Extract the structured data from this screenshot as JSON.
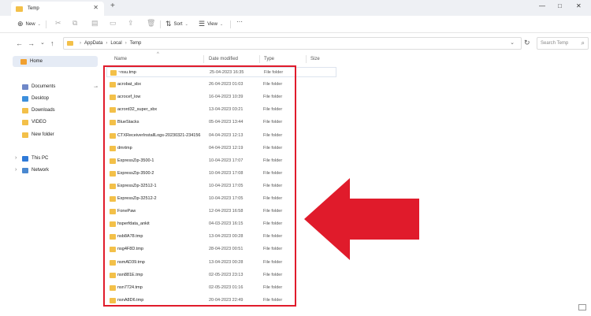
{
  "window": {
    "tab_title": "Temp",
    "tab_close": "✕",
    "new_tab": "+",
    "minimize": "—",
    "maximize": "□",
    "close": "✕"
  },
  "toolbar": {
    "new_label": "New",
    "sort_label": "Sort",
    "view_label": "View",
    "more_label": "···"
  },
  "address": {
    "crumbs": [
      "AppData",
      "Local",
      "Temp"
    ],
    "search_placeholder": "Search Temp"
  },
  "sidebar": {
    "home": "Home",
    "items": [
      "Documents",
      "Desktop",
      "Downloads",
      "VIDEO",
      "New folder"
    ],
    "this_pc": "This PC",
    "network": "Network"
  },
  "columns": {
    "name": "Name",
    "date": "Date modified",
    "type": "Type",
    "size": "Size"
  },
  "rows": [
    {
      "name": "~nsu.tmp",
      "date": "25-04-2023 16:35",
      "type": "File folder"
    },
    {
      "name": "acrobat_sbx",
      "date": "26-04-2023 01:03",
      "type": "File folder"
    },
    {
      "name": "acrocef_low",
      "date": "16-04-2023 10:39",
      "type": "File folder"
    },
    {
      "name": "acrord32_super_sbx",
      "date": "13-04-2023 03:21",
      "type": "File folder"
    },
    {
      "name": "BlueStacks",
      "date": "05-04-2023 13:44",
      "type": "File folder"
    },
    {
      "name": "CTXReceiverInstallLogs-20230321-234156",
      "date": "04-04-2023 12:13",
      "type": "File folder"
    },
    {
      "name": "dmrtmp",
      "date": "04-04-2023 12:19",
      "type": "File folder"
    },
    {
      "name": "ExpressZip-3500-1",
      "date": "10-04-2023 17:07",
      "type": "File folder"
    },
    {
      "name": "ExpressZip-3500-2",
      "date": "10-04-2023 17:08",
      "type": "File folder"
    },
    {
      "name": "ExpressZip-32512-1",
      "date": "10-04-2023 17:05",
      "type": "File folder"
    },
    {
      "name": "ExpressZip-32512-2",
      "date": "10-04-2023 17:05",
      "type": "File folder"
    },
    {
      "name": "FonePaw",
      "date": "12-04-2023 16:58",
      "type": "File folder"
    },
    {
      "name": "hsperfdata_ankit",
      "date": "04-03-2023 16:15",
      "type": "File folder"
    },
    {
      "name": "nsb8A78.tmp",
      "date": "13-04-2023 00:28",
      "type": "File folder"
    },
    {
      "name": "nsg4F8D.tmp",
      "date": "28-04-2023 00:51",
      "type": "File folder"
    },
    {
      "name": "nsmAD39.tmp",
      "date": "13-04-2023 00:28",
      "type": "File folder"
    },
    {
      "name": "nsn881E.tmp",
      "date": "02-05-2023 23:13",
      "type": "File folder"
    },
    {
      "name": "nsn7724.tmp",
      "date": "02-05-2023 01:16",
      "type": "File folder"
    },
    {
      "name": "nsnA8D6.tmp",
      "date": "20-04-2023 22:49",
      "type": "File folder"
    }
  ],
  "colors": {
    "highlight": "#e01b2b",
    "folder": "#f3c049"
  }
}
